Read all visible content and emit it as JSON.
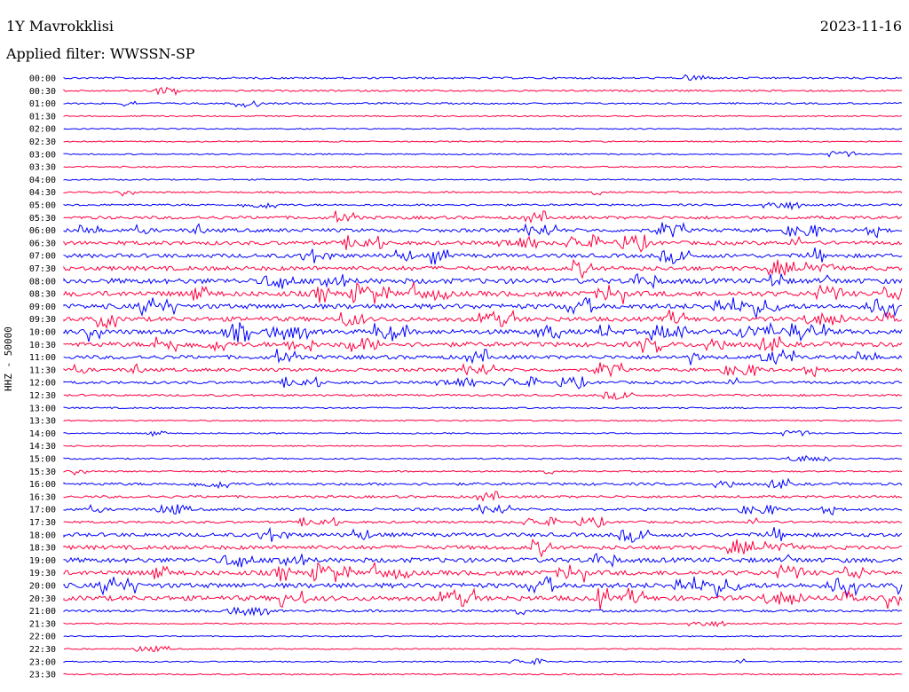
{
  "header": {
    "station": "1Y Mavrokklisi",
    "date": "2023-11-16",
    "filter": "Applied filter: WWSSN-SP"
  },
  "axis": {
    "ylabel": "HHZ - 50000"
  },
  "colors": {
    "even_trace": "#0000ff",
    "odd_trace": "#ff0040"
  },
  "rows": [
    {
      "time": "00:00",
      "activity": 0.18
    },
    {
      "time": "00:30",
      "activity": 0.15
    },
    {
      "time": "01:00",
      "activity": 0.12
    },
    {
      "time": "01:30",
      "activity": 0.05
    },
    {
      "time": "02:00",
      "activity": 0.03
    },
    {
      "time": "02:30",
      "activity": 0.03
    },
    {
      "time": "03:00",
      "activity": 0.04
    },
    {
      "time": "03:30",
      "activity": 0.08
    },
    {
      "time": "04:00",
      "activity": 0.05
    },
    {
      "time": "04:30",
      "activity": 0.12
    },
    {
      "time": "05:00",
      "activity": 0.2
    },
    {
      "time": "05:30",
      "activity": 0.45
    },
    {
      "time": "06:00",
      "activity": 0.55
    },
    {
      "time": "06:30",
      "activity": 0.6
    },
    {
      "time": "07:00",
      "activity": 0.65
    },
    {
      "time": "07:30",
      "activity": 0.7
    },
    {
      "time": "08:00",
      "activity": 0.9
    },
    {
      "time": "08:30",
      "activity": 0.9
    },
    {
      "time": "09:00",
      "activity": 0.85
    },
    {
      "time": "09:30",
      "activity": 0.75
    },
    {
      "time": "10:00",
      "activity": 0.8
    },
    {
      "time": "10:30",
      "activity": 0.8
    },
    {
      "time": "11:00",
      "activity": 0.6
    },
    {
      "time": "11:30",
      "activity": 0.5
    },
    {
      "time": "12:00",
      "activity": 0.35
    },
    {
      "time": "12:30",
      "activity": 0.2
    },
    {
      "time": "13:00",
      "activity": 0.1
    },
    {
      "time": "13:30",
      "activity": 0.04
    },
    {
      "time": "14:00",
      "activity": 0.03
    },
    {
      "time": "14:30",
      "activity": 0.04
    },
    {
      "time": "15:00",
      "activity": 0.08
    },
    {
      "time": "15:30",
      "activity": 0.1
    },
    {
      "time": "16:00",
      "activity": 0.35
    },
    {
      "time": "16:30",
      "activity": 0.3
    },
    {
      "time": "17:00",
      "activity": 0.35
    },
    {
      "time": "17:30",
      "activity": 0.25
    },
    {
      "time": "18:00",
      "activity": 0.6
    },
    {
      "time": "18:30",
      "activity": 0.65
    },
    {
      "time": "19:00",
      "activity": 0.8
    },
    {
      "time": "19:30",
      "activity": 0.8
    },
    {
      "time": "20:00",
      "activity": 0.85
    },
    {
      "time": "20:30",
      "activity": 0.85
    },
    {
      "time": "21:00",
      "activity": 0.3
    },
    {
      "time": "21:30",
      "activity": 0.05
    },
    {
      "time": "22:00",
      "activity": 0.02
    },
    {
      "time": "22:30",
      "activity": 0.02
    },
    {
      "time": "23:00",
      "activity": 0.02
    },
    {
      "time": "23:30",
      "activity": 0.06
    }
  ]
}
